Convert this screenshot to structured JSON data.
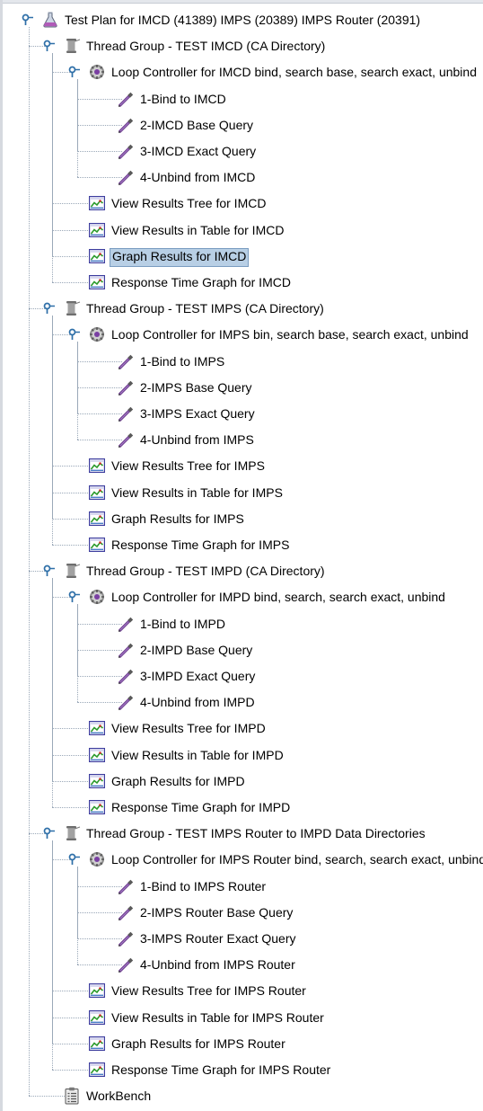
{
  "tree": {
    "nodes": [
      {
        "depth": 0,
        "type": "testplan",
        "label": "Test Plan for IMCD (41389) IMPS  (20389)  IMPS Router (20391)",
        "handle": "expanded"
      },
      {
        "depth": 1,
        "type": "threadgroup",
        "label": "Thread Group - TEST IMCD (CA Directory)",
        "handle": "expanded"
      },
      {
        "depth": 2,
        "type": "loop",
        "label": "Loop Controller for IMCD bind, search base, search exact, unbind",
        "handle": "expanded"
      },
      {
        "depth": 3,
        "type": "sampler",
        "label": "1-Bind to IMCD",
        "last": false
      },
      {
        "depth": 3,
        "type": "sampler",
        "label": "2-IMCD Base Query",
        "last": false
      },
      {
        "depth": 3,
        "type": "sampler",
        "label": "3-IMCD Exact Query",
        "last": false
      },
      {
        "depth": 3,
        "type": "sampler",
        "label": "4-Unbind from IMCD",
        "last": true
      },
      {
        "depth": 2,
        "type": "listener",
        "label": "View Results Tree for IMCD",
        "last": false
      },
      {
        "depth": 2,
        "type": "listener",
        "label": "View Results in Table for IMCD",
        "last": false
      },
      {
        "depth": 2,
        "type": "listener",
        "label": "Graph Results for IMCD",
        "selected": true,
        "last": false
      },
      {
        "depth": 2,
        "type": "listener",
        "label": "Response Time Graph for IMCD",
        "last": true
      },
      {
        "depth": 1,
        "type": "threadgroup",
        "label": "Thread Group - TEST IMPS (CA Directory)",
        "handle": "expanded"
      },
      {
        "depth": 2,
        "type": "loop",
        "label": "Loop Controller for IMPS bin, search base, search exact, unbind",
        "handle": "expanded"
      },
      {
        "depth": 3,
        "type": "sampler",
        "label": "1-Bind to IMPS",
        "last": false
      },
      {
        "depth": 3,
        "type": "sampler",
        "label": "2-IMPS Base Query",
        "last": false
      },
      {
        "depth": 3,
        "type": "sampler",
        "label": "3-IMPS Exact Query",
        "last": false
      },
      {
        "depth": 3,
        "type": "sampler",
        "label": "4-Unbind from IMPS",
        "last": true
      },
      {
        "depth": 2,
        "type": "listener",
        "label": "View Results Tree for IMPS",
        "last": false
      },
      {
        "depth": 2,
        "type": "listener",
        "label": "View Results in Table for IMPS",
        "last": false
      },
      {
        "depth": 2,
        "type": "listener",
        "label": "Graph Results for IMPS",
        "last": false
      },
      {
        "depth": 2,
        "type": "listener",
        "label": "Response Time Graph for IMPS",
        "last": true
      },
      {
        "depth": 1,
        "type": "threadgroup",
        "label": "Thread Group - TEST IMPD (CA Directory)",
        "handle": "expanded"
      },
      {
        "depth": 2,
        "type": "loop",
        "label": "Loop Controller for IMPD bind, search, search exact, unbind",
        "handle": "expanded"
      },
      {
        "depth": 3,
        "type": "sampler",
        "label": "1-Bind to IMPD",
        "last": false
      },
      {
        "depth": 3,
        "type": "sampler",
        "label": "2-IMPD Base Query",
        "last": false
      },
      {
        "depth": 3,
        "type": "sampler",
        "label": "3-IMPD Exact Query",
        "last": false
      },
      {
        "depth": 3,
        "type": "sampler",
        "label": "4-Unbind from IMPD",
        "last": true
      },
      {
        "depth": 2,
        "type": "listener",
        "label": "View Results Tree for IMPD",
        "last": false
      },
      {
        "depth": 2,
        "type": "listener",
        "label": "View Results in Table for IMPD",
        "last": false
      },
      {
        "depth": 2,
        "type": "listener",
        "label": "Graph Results for IMPD",
        "last": false
      },
      {
        "depth": 2,
        "type": "listener",
        "label": "Response Time Graph for IMPD",
        "last": true
      },
      {
        "depth": 1,
        "type": "threadgroup",
        "label": "Thread Group - TEST IMPS Router to IMPD Data Directories",
        "handle": "expanded"
      },
      {
        "depth": 2,
        "type": "loop",
        "label": "Loop Controller for IMPS Router bind, search, search exact, unbind",
        "handle": "expanded"
      },
      {
        "depth": 3,
        "type": "sampler",
        "label": "1-Bind to IMPS Router",
        "last": false
      },
      {
        "depth": 3,
        "type": "sampler",
        "label": "2-IMPS Router Base Query",
        "last": false
      },
      {
        "depth": 3,
        "type": "sampler",
        "label": "3-IMPS Router Exact Query",
        "last": false
      },
      {
        "depth": 3,
        "type": "sampler",
        "label": "4-Unbind from IMPS Router",
        "last": true
      },
      {
        "depth": 2,
        "type": "listener",
        "label": "View Results Tree for IMPS Router",
        "last": false
      },
      {
        "depth": 2,
        "type": "listener",
        "label": "View Results in Table for IMPS Router",
        "last": false
      },
      {
        "depth": 2,
        "type": "listener",
        "label": "Graph Results for IMPS Router",
        "last": false
      },
      {
        "depth": 2,
        "type": "listener",
        "label": "Response Time Graph for IMPS Router",
        "last": true
      },
      {
        "depth": 1,
        "type": "workbench",
        "label": "WorkBench",
        "last": true
      }
    ]
  },
  "icons": {
    "testplan": "flask-icon",
    "threadgroup": "spool-icon",
    "loop": "gear-loop-icon",
    "sampler": "pipette-icon",
    "listener": "results-graph-icon",
    "workbench": "clipboard-icon"
  },
  "colors": {
    "selection_bg": "#b8cfe5",
    "selection_border": "#7a9cc0",
    "tree_lines": "#9aa8b8",
    "handle": "#2e6fa8",
    "listener_border": "#3d3d9e",
    "listener_line": "#2a9a2a",
    "listener_dot": "#d23030"
  }
}
